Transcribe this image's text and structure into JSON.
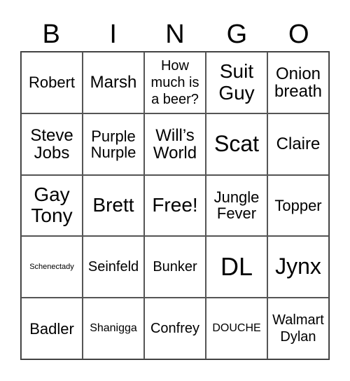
{
  "header": [
    "B",
    "I",
    "N",
    "G",
    "O"
  ],
  "cells": [
    [
      "Robert",
      "Marsh",
      "How\nmuch is\na beer?",
      "Suit\nGuy",
      "Onion\nbreath"
    ],
    [
      "Steve\nJobs",
      "Purple\nNurple",
      "Will’s\nWorld",
      "Scat",
      "Claire"
    ],
    [
      "Gay\nTony",
      "Brett",
      "Free!",
      "Jungle\nFever",
      "Topper"
    ],
    [
      "Schenectady",
      "Seinfeld",
      "Bunker",
      "DL",
      "Jynx"
    ],
    [
      "Badler",
      "Shanigga",
      "Confrey",
      "DOUCHE",
      "Walmart\nDylan"
    ]
  ]
}
